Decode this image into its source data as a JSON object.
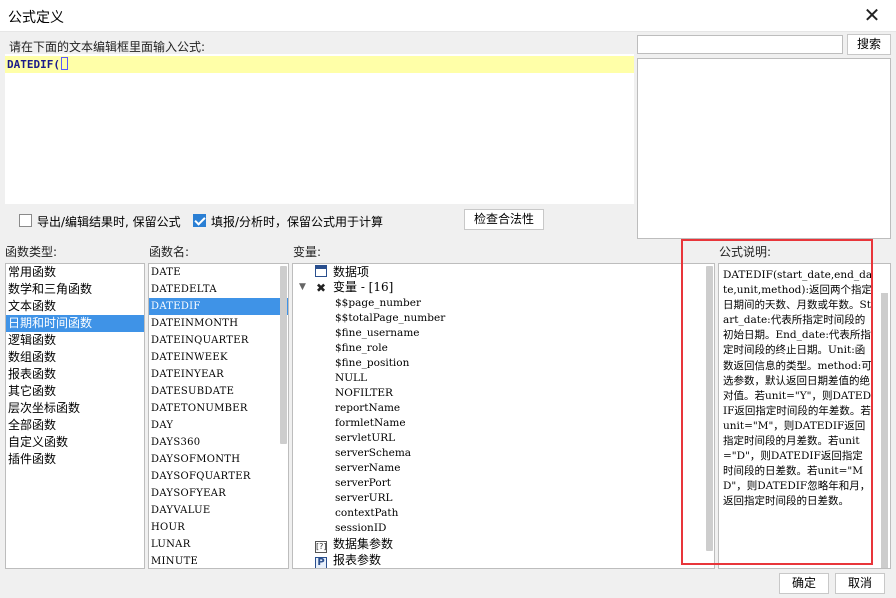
{
  "window": {
    "title": "公式定义",
    "close_glyph": "✕"
  },
  "editor": {
    "prompt": "请在下面的文本编辑框里面输入公式:",
    "formula": "DATEDIF",
    "open_paren": "(",
    "highlight_color": "#ffffa8"
  },
  "search": {
    "value": "",
    "button": "搜索"
  },
  "options": {
    "keep_on_export": {
      "label": "导出/编辑结果时, 保留公式",
      "checked": false
    },
    "keep_on_fill": {
      "label": "填报/分析时，保留公式用于计算",
      "checked": true
    }
  },
  "validate_button": "检查合法性",
  "panels": {
    "categories_label": "函数类型:",
    "functions_label": "函数名:",
    "variables_label": "变量:",
    "description_label": "公式说明:"
  },
  "categories": [
    "常用函数",
    "数学和三角函数",
    "文本函数",
    "日期和时间函数",
    "逻辑函数",
    "数组函数",
    "报表函数",
    "其它函数",
    "层次坐标函数",
    "全部函数",
    "自定义函数",
    "插件函数"
  ],
  "selected_category": 3,
  "functions": [
    "DATE",
    "DATEDELTA",
    "DATEDIF",
    "DATEINMONTH",
    "DATEINQUARTER",
    "DATEINWEEK",
    "DATEINYEAR",
    "DATESUBDATE",
    "DATETONUMBER",
    "DAY",
    "DAYS360",
    "DAYSOFMONTH",
    "DAYSOFQUARTER",
    "DAYSOFYEAR",
    "DAYVALUE",
    "HOUR",
    "LUNAR",
    "MINUTE"
  ],
  "selected_function": 2,
  "variables": {
    "data_items": "数据项",
    "var_group": "变量 - [16]",
    "vars": [
      "$$page_number",
      "$$totalPage_number",
      "$fine_username",
      "$fine_role",
      "$fine_position",
      "NULL",
      "NOFILTER",
      "reportName",
      "formletName",
      "servletURL",
      "serverSchema",
      "serverName",
      "serverPort",
      "serverURL",
      "contextPath",
      "sessionID"
    ],
    "dataset_params": "数据集参数",
    "report_params": "报表参数",
    "param_icon_letter": "P"
  },
  "description": "DATEDIF(start_date,end_date,unit,method):返回两个指定日期间的天数、月数或年数。Start_date:代表所指定时间段的初始日期。End_date:代表所指定时间段的终止日期。Unit:函数返回信息的类型。method:可选参数，默认返回日期差值的绝对值。若unit=\"Y\"，则DATEDIF返回指定时间段的年差数。若unit=\"M\"，则DATEDIF返回指定时间段的月差数。若unit=\"D\"，则DATEDIF返回指定时间段的日差数。若unit=\"MD\"，则DATEDIF忽略年和月，返回指定时间段的日差数。",
  "highlight_border_color": "#e8353a",
  "selection_color": "#3f93e7",
  "buttons": {
    "ok": "确定",
    "cancel": "取消"
  }
}
